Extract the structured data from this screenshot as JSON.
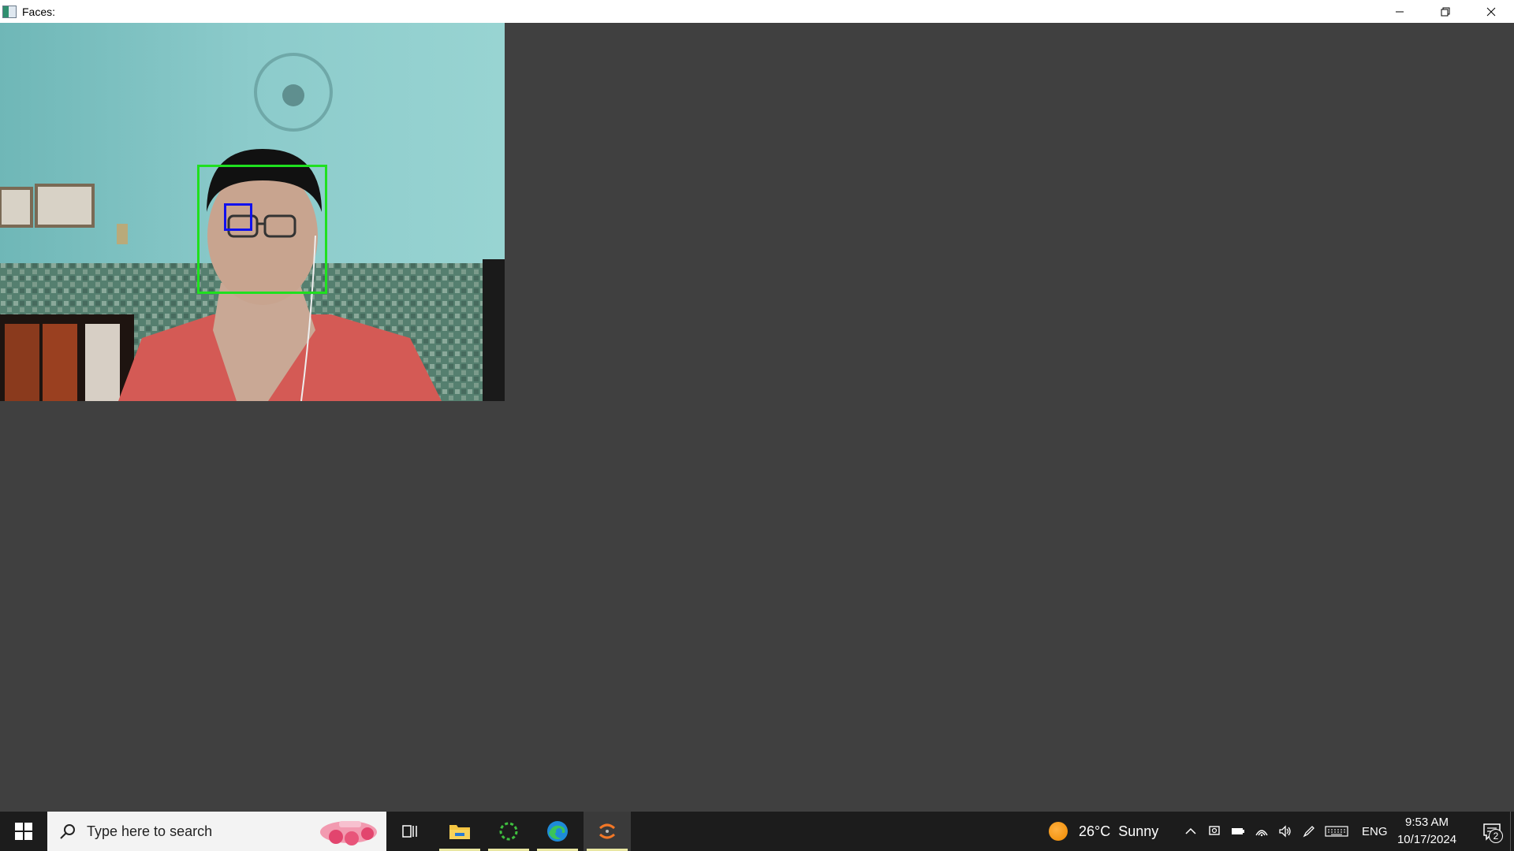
{
  "window": {
    "title": "Faces:",
    "icon": "app-window-icon",
    "controls": [
      "minimize-icon",
      "restore-icon",
      "close-icon"
    ]
  },
  "camera": {
    "detections": [
      {
        "type": "face",
        "color": "#1fe01f"
      },
      {
        "type": "eye",
        "color": "#1010ee"
      }
    ]
  },
  "taskbar": {
    "search_placeholder": "Type here to search",
    "pinned": [
      {
        "name": "task-view-icon"
      },
      {
        "name": "file-explorer-icon"
      },
      {
        "name": "loading-app-icon"
      },
      {
        "name": "edge-browser-icon"
      },
      {
        "name": "python-app-icon"
      }
    ],
    "weather": {
      "temp": "26°C",
      "condition": "Sunny"
    },
    "language": "ENG",
    "time": "9:53 AM",
    "date": "10/17/2024",
    "notification_count": "2"
  }
}
